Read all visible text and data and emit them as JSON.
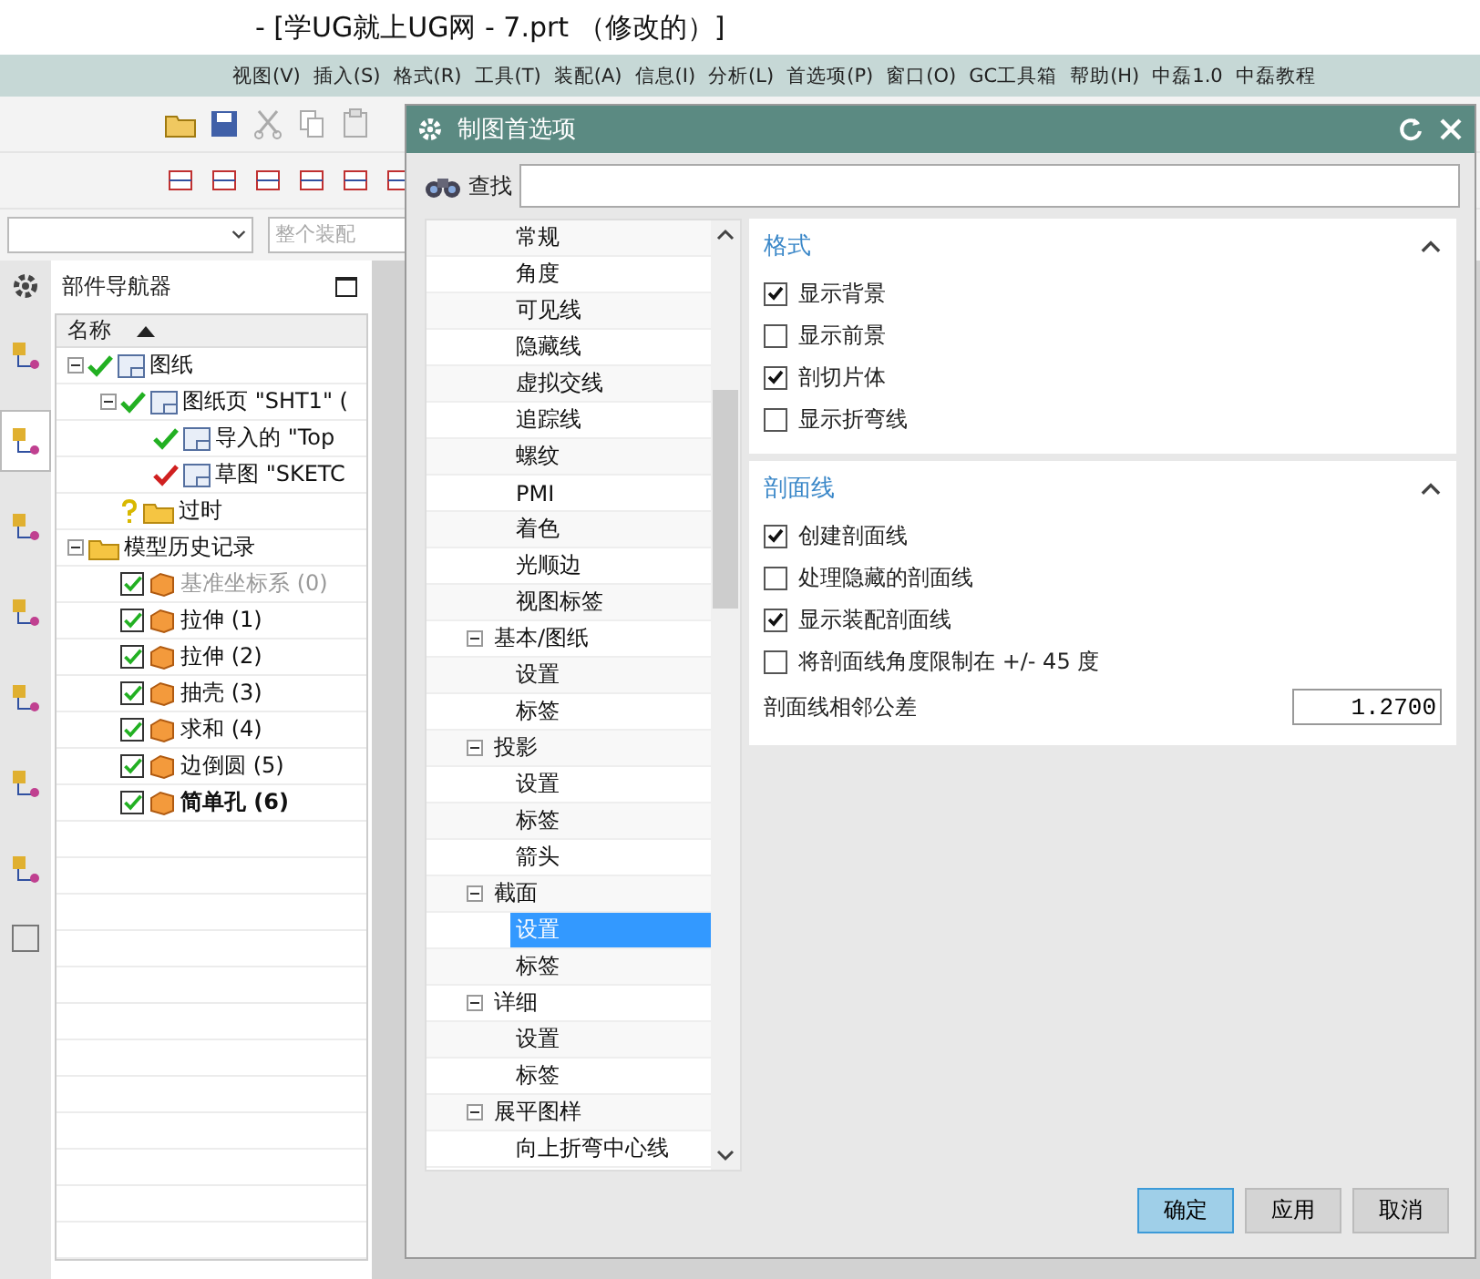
{
  "window": {
    "title": "- [学UG就上UG网 - 7.prt （修改的）]"
  },
  "menu": [
    "视图(V)",
    "插入(S)",
    "格式(R)",
    "工具(T)",
    "装配(A)",
    "信息(I)",
    "分析(L)",
    "首选项(P)",
    "窗口(O)",
    "GC工具箱",
    "帮助(H)",
    "中磊1.0",
    "中磊教程"
  ],
  "filter_bar": {
    "placeholder": "整个装配"
  },
  "side_tabs": [
    {
      "selected": false
    },
    {
      "selected": true
    },
    {
      "selected": false
    },
    {
      "selected": false
    },
    {
      "selected": false
    },
    {
      "selected": false
    },
    {
      "selected": false
    }
  ],
  "navigator": {
    "title": "部件导航器",
    "column": "名称",
    "tree": [
      {
        "kind": "node",
        "label": "图纸",
        "modified": false,
        "expanded": true,
        "children": [
          {
            "kind": "node",
            "label": "图纸页 \"SHT1\" (",
            "modified": false,
            "expanded": true,
            "children": [
              {
                "kind": "node",
                "label": "导入的 \"Top",
                "modified": false
              },
              {
                "kind": "node",
                "label": "草图 \"SKETC",
                "modified": true
              }
            ]
          },
          {
            "kind": "folder",
            "label": "过时",
            "unknown": true
          }
        ]
      },
      {
        "kind": "folder",
        "label": "模型历史记录",
        "expanded": true,
        "children": [
          {
            "kind": "feature",
            "label": "基准坐标系 (0)",
            "checked": true,
            "dimmed": true,
            "current": false
          },
          {
            "kind": "feature",
            "label": "拉伸 (1)",
            "checked": true,
            "dimmed": false,
            "current": false
          },
          {
            "kind": "feature",
            "label": "拉伸 (2)",
            "checked": true,
            "dimmed": false,
            "current": false
          },
          {
            "kind": "feature",
            "label": "抽壳 (3)",
            "checked": true,
            "dimmed": false,
            "current": false
          },
          {
            "kind": "feature",
            "label": "求和 (4)",
            "checked": true,
            "dimmed": false,
            "current": false
          },
          {
            "kind": "feature",
            "label": "边倒圆 (5)",
            "checked": true,
            "dimmed": false,
            "current": false
          },
          {
            "kind": "feature",
            "label": "简单孔 (6)",
            "checked": true,
            "dimmed": false,
            "current": true
          }
        ]
      }
    ]
  },
  "dialog": {
    "title": "制图首选项",
    "search": {
      "label": "查找"
    },
    "tree": {
      "leading_items": [
        {
          "label": "常规",
          "selected": false
        },
        {
          "label": "角度",
          "selected": false
        },
        {
          "label": "可见线",
          "selected": false
        },
        {
          "label": "隐藏线",
          "selected": false
        },
        {
          "label": "虚拟交线",
          "selected": false
        },
        {
          "label": "追踪线",
          "selected": false
        },
        {
          "label": "螺纹",
          "selected": false
        },
        {
          "label": "PMI",
          "selected": false
        },
        {
          "label": "着色",
          "selected": false
        },
        {
          "label": "光顺边",
          "selected": false
        },
        {
          "label": "视图标签",
          "selected": false
        }
      ],
      "groups": [
        {
          "label": "基本/图纸",
          "expanded": true,
          "children": [
            {
              "label": "设置",
              "selected": false
            },
            {
              "label": "标签",
              "selected": false
            }
          ]
        },
        {
          "label": "投影",
          "expanded": true,
          "children": [
            {
              "label": "设置",
              "selected": false
            },
            {
              "label": "标签",
              "selected": false
            },
            {
              "label": "箭头",
              "selected": false
            }
          ]
        },
        {
          "label": "截面",
          "expanded": true,
          "children": [
            {
              "label": "设置",
              "selected": true
            },
            {
              "label": "标签",
              "selected": false
            }
          ]
        },
        {
          "label": "详细",
          "expanded": true,
          "children": [
            {
              "label": "设置",
              "selected": false
            },
            {
              "label": "标签",
              "selected": false
            }
          ]
        },
        {
          "label": "展平图样",
          "expanded": true,
          "children": [
            {
              "label": "向上折弯中心线",
              "selected": false
            }
          ]
        }
      ]
    },
    "sections": [
      {
        "title": "格式",
        "expanded": true,
        "options": [
          {
            "kind": "checkbox",
            "label": "显示背景",
            "checked": true
          },
          {
            "kind": "checkbox",
            "label": "显示前景",
            "checked": false
          },
          {
            "kind": "checkbox",
            "label": "剖切片体",
            "checked": true
          },
          {
            "kind": "checkbox",
            "label": "显示折弯线",
            "checked": false
          }
        ]
      },
      {
        "title": "剖面线",
        "expanded": true,
        "options": [
          {
            "kind": "checkbox",
            "label": "创建剖面线",
            "checked": true
          },
          {
            "kind": "checkbox",
            "label": "处理隐藏的剖面线",
            "checked": false
          },
          {
            "kind": "checkbox",
            "label": "显示装配剖面线",
            "checked": true
          },
          {
            "kind": "checkbox",
            "label": "将剖面线角度限制在 +/- 45 度",
            "checked": false
          },
          {
            "kind": "number",
            "label": "剖面线相邻公差",
            "value": "1.2700"
          }
        ]
      }
    ],
    "buttons": [
      {
        "label": "确定",
        "primary": true
      },
      {
        "label": "应用",
        "primary": false
      },
      {
        "label": "取消",
        "primary": false
      }
    ]
  }
}
